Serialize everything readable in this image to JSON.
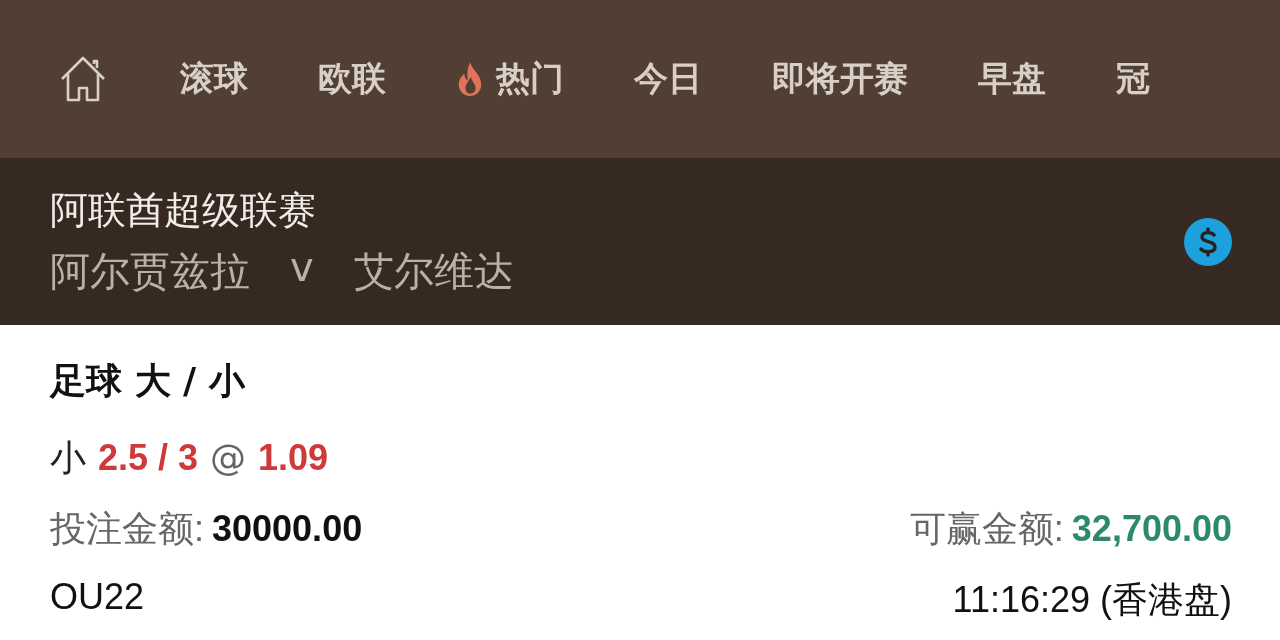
{
  "nav": {
    "items": [
      {
        "label": "滚球",
        "kind": "text"
      },
      {
        "label": "欧联",
        "kind": "text"
      },
      {
        "label": "热门",
        "kind": "hot"
      },
      {
        "label": "今日",
        "kind": "text"
      },
      {
        "label": "即将开赛",
        "kind": "text"
      },
      {
        "label": "早盘",
        "kind": "text"
      },
      {
        "label": "冠",
        "kind": "text"
      }
    ]
  },
  "match": {
    "league": "阿联酋超级联赛",
    "home": "阿尔贾兹拉",
    "vs": "v",
    "away": "艾尔维达"
  },
  "bet": {
    "title": "足球 大 / 小",
    "side": "小",
    "line": "2.5 / 3",
    "at": "@",
    "odds": "1.09",
    "stake_label": "投注金额:",
    "stake": "30000.00",
    "win_label": "可赢金额:",
    "win": "32,700.00",
    "ref": "OU22",
    "time": "11:16:29 (香港盘)"
  }
}
